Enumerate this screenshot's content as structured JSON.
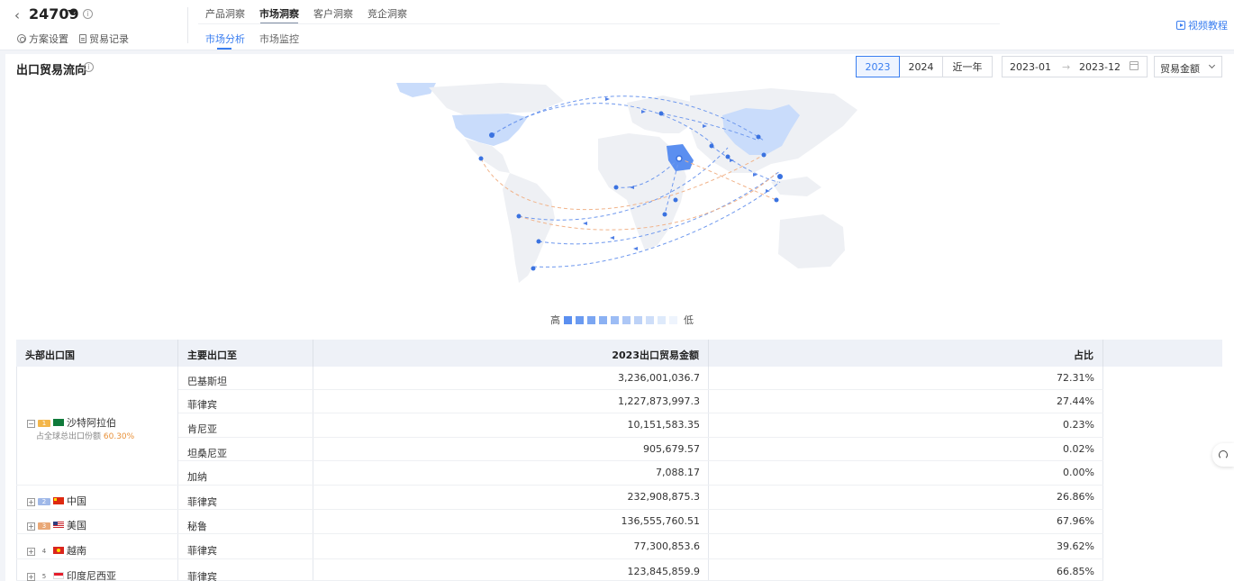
{
  "header": {
    "back_icon": "chevron-left-icon",
    "project_id": "24709",
    "scheme_settings": "方案设置",
    "trade_records": "贸易记录",
    "primary_tabs": [
      {
        "label": "产品洞察",
        "active": false
      },
      {
        "label": "市场洞察",
        "active": true
      },
      {
        "label": "客户洞察",
        "active": false
      },
      {
        "label": "竞企洞察",
        "active": false
      }
    ],
    "secondary_tabs": [
      {
        "label": "市场分析",
        "active": true
      },
      {
        "label": "市场监控",
        "active": false
      }
    ],
    "video_tutorial": "视频教程"
  },
  "section": {
    "title": "出口贸易流向",
    "year_buttons": [
      {
        "label": "2023",
        "active": true
      },
      {
        "label": "2024",
        "active": false
      },
      {
        "label": "近一年",
        "active": false
      }
    ],
    "date_start": "2023-01",
    "date_arrow": "→",
    "date_end": "2023-12",
    "metric_select": "贸易金额"
  },
  "map": {
    "highlight_color": "#5b8ff0",
    "light_color": "#c9dcfb",
    "land_color": "#eef0f4",
    "route_color_blue": "#6e98ee",
    "route_color_orange": "#f1b38a",
    "legend_high": "高",
    "legend_low": "低",
    "legend_colors": [
      "#5b8ff0",
      "#6b9bf1",
      "#7ba6f2",
      "#8bb1f3",
      "#9cbcf5",
      "#adc7f6",
      "#bdd2f7",
      "#cedef9",
      "#deeafb",
      "#eef4fd"
    ]
  },
  "table": {
    "headers": [
      "头部出口国",
      "主要出口至",
      "2023出口贸易金额",
      "占比"
    ],
    "share_label": "占全球总出口份额",
    "groups": [
      {
        "rank": "1",
        "country": "沙特阿拉伯",
        "flag": "sa",
        "expanded": true,
        "share": "60.30%",
        "rows": [
          {
            "dest": "巴基斯坦",
            "amount": "3,236,001,036.7",
            "pct": "72.31%"
          },
          {
            "dest": "菲律宾",
            "amount": "1,227,873,997.3",
            "pct": "27.44%"
          },
          {
            "dest": "肯尼亚",
            "amount": "10,151,583.35",
            "pct": "0.23%"
          },
          {
            "dest": "坦桑尼亚",
            "amount": "905,679.57",
            "pct": "0.02%"
          },
          {
            "dest": "加纳",
            "amount": "7,088.17",
            "pct": "0.00%"
          }
        ]
      },
      {
        "rank": "2",
        "country": "中国",
        "flag": "cn",
        "expanded": false,
        "rows": [
          {
            "dest": "菲律宾",
            "amount": "232,908,875.3",
            "pct": "26.86%"
          }
        ]
      },
      {
        "rank": "3",
        "country": "美国",
        "flag": "us",
        "expanded": false,
        "rows": [
          {
            "dest": "秘鲁",
            "amount": "136,555,760.51",
            "pct": "67.96%"
          }
        ]
      },
      {
        "rank": "4",
        "country": "越南",
        "flag": "vn",
        "expanded": false,
        "rows": [
          {
            "dest": "菲律宾",
            "amount": "77,300,853.6",
            "pct": "39.62%"
          }
        ]
      },
      {
        "rank": "5",
        "country": "印度尼西亚",
        "flag": "id",
        "expanded": false,
        "rows": [
          {
            "dest": "菲律宾",
            "amount": "123,845,859.9",
            "pct": "66.85%"
          }
        ]
      }
    ]
  },
  "floating_button_icon": "headset-icon"
}
